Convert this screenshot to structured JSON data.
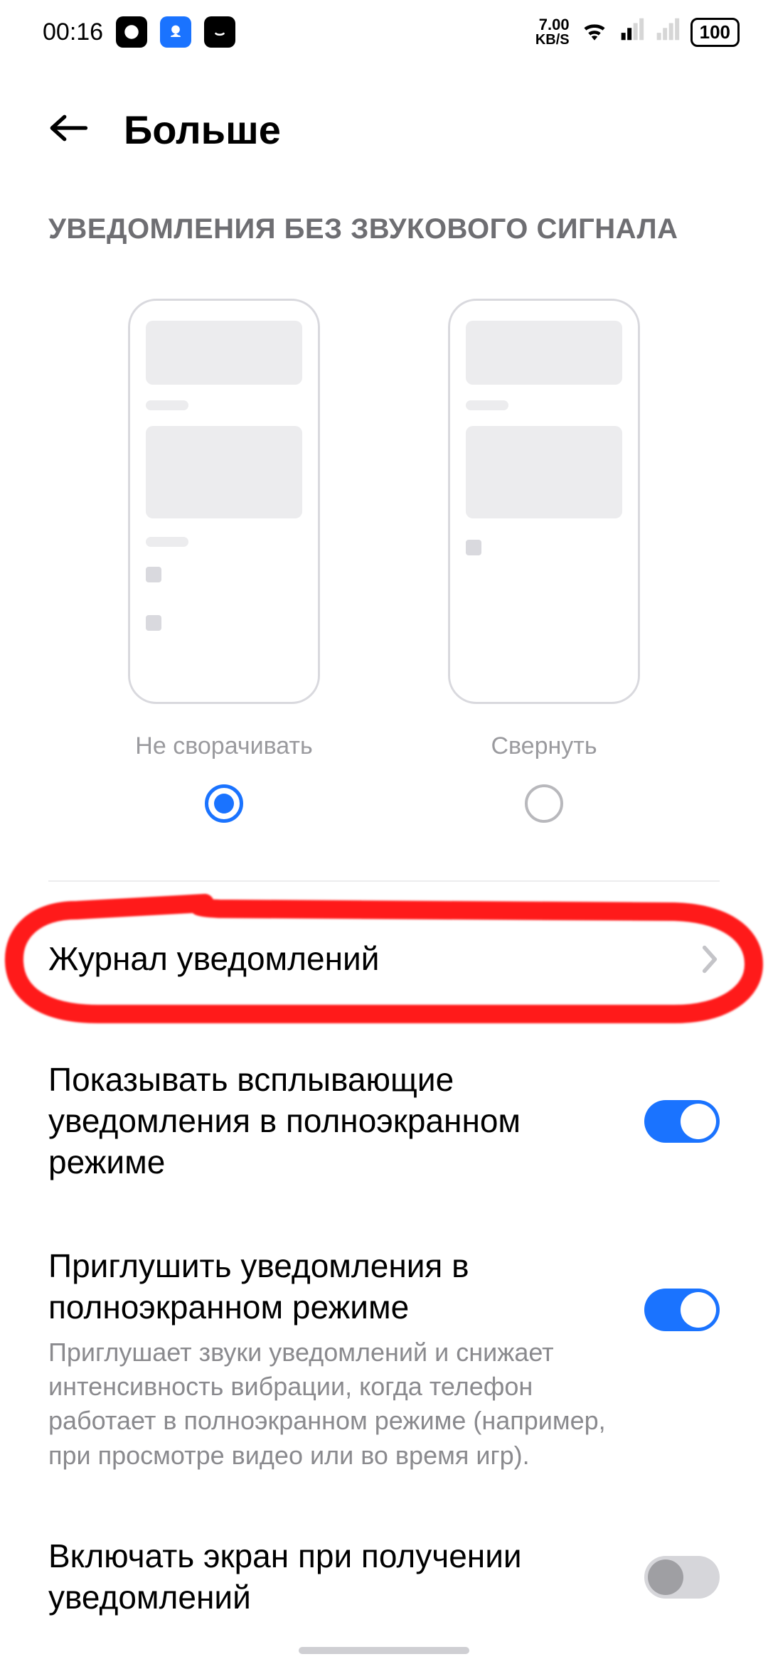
{
  "status": {
    "time": "00:16",
    "speed_value": "7.00",
    "speed_unit": "KB/S",
    "battery": "100"
  },
  "header": {
    "title": "Больше"
  },
  "section": {
    "label": "УВЕДОМЛЕНИЯ БЕЗ ЗВУКОВОГО СИГНАЛА"
  },
  "options": {
    "a": {
      "label": "Не сворачивать",
      "selected": true
    },
    "b": {
      "label": "Свернуть",
      "selected": false
    }
  },
  "rows": {
    "log": {
      "title": "Журнал уведомлений"
    },
    "popup": {
      "title": "Показывать всплывающие уведомления в полноэкранном режиме"
    },
    "mute": {
      "title": "Приглушить уведомления в полноэкранном режиме",
      "sub": "Приглушает звуки уведомлений и снижает интенсивность вибрации, когда телефон работает в полноэкранном режиме (например, при просмотре видео или во время игр)."
    },
    "wake": {
      "title": "Включать экран при получении уведомлений"
    }
  },
  "colors": {
    "accent": "#1a73ff",
    "annotation": "#ff0000"
  }
}
